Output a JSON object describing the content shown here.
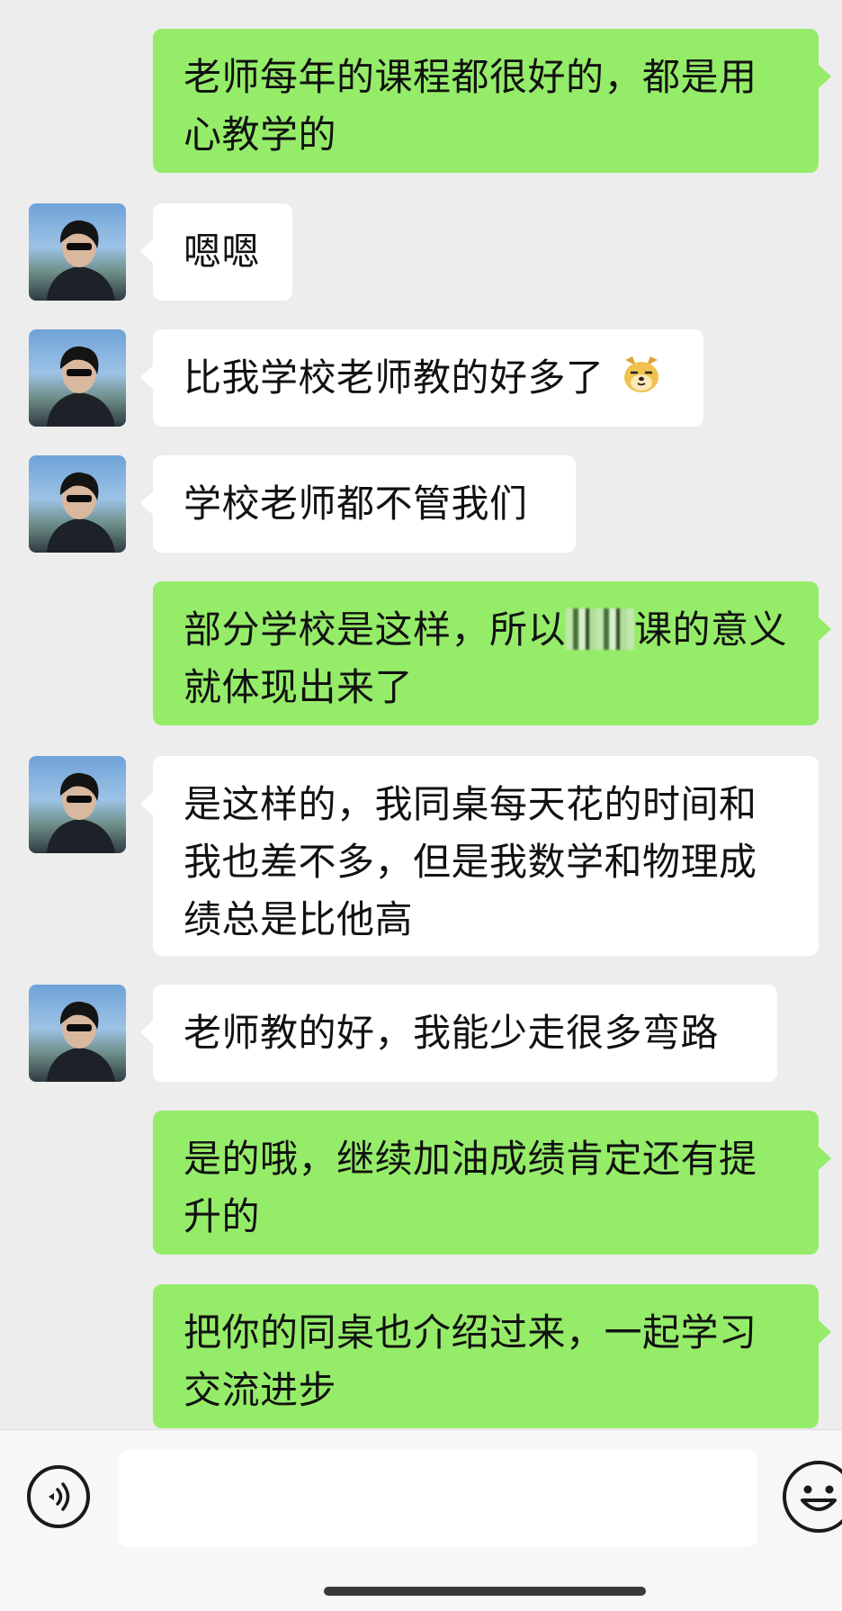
{
  "messages": [
    {
      "side": "right",
      "text": "老师每年的课程都很好的，都是用心教学的"
    },
    {
      "side": "left",
      "text": "嗯嗯"
    },
    {
      "side": "left",
      "text": "比我学校老师教的好多了",
      "emoji": "doge-emoji"
    },
    {
      "side": "left",
      "text": "学校老师都不管我们"
    },
    {
      "side": "right",
      "text_before": "部分学校是这样，所以",
      "text_after": "课的意义就体现出来了",
      "redacted": true
    },
    {
      "side": "left",
      "text": "是这样的，我同桌每天花的时间和我也差不多，但是我数学和物理成绩总是比他高"
    },
    {
      "side": "left",
      "text": "老师教的好，我能少走很多弯路"
    },
    {
      "side": "right",
      "text": "是的哦，继续加油成绩肯定还有提升的"
    },
    {
      "side": "right",
      "text": "把你的同桌也介绍过来，一起学习交流进步"
    }
  ],
  "input_bar": {
    "voice_icon": "voice-icon",
    "emoji_icon": "emoji-icon",
    "text_value": ""
  },
  "colors": {
    "background": "#ededed",
    "sent_bubble": "#95ec69",
    "received_bubble": "#ffffff"
  }
}
